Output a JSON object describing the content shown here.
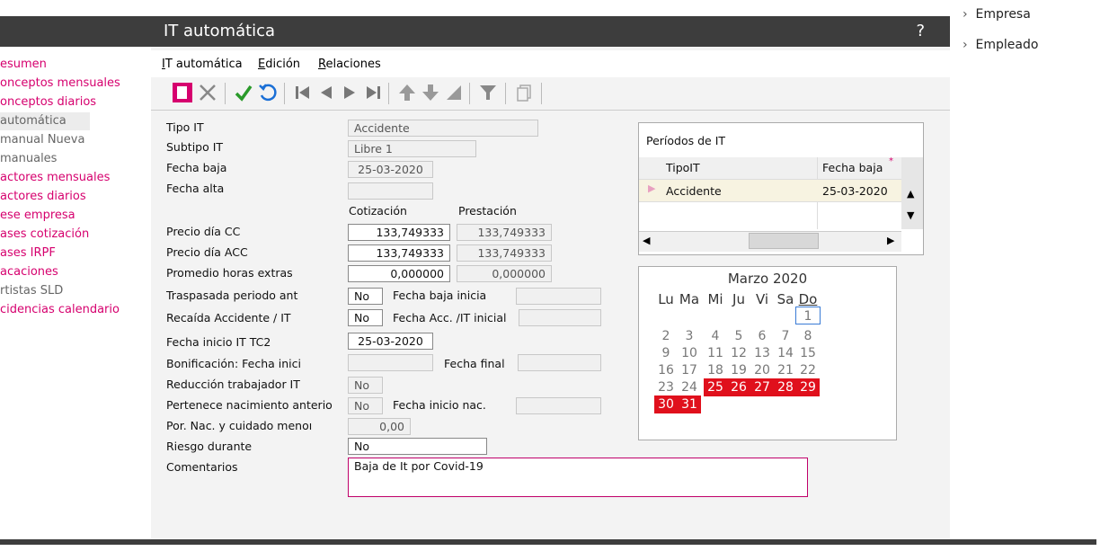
{
  "sidebar": {
    "items": [
      {
        "label": "esumen",
        "type": "main"
      },
      {
        "label": "onceptos mensuales",
        "type": "main"
      },
      {
        "label": "onceptos diarios",
        "type": "main"
      },
      {
        "label": " automática",
        "type": "sub"
      },
      {
        "label": " manual Nueva",
        "type": "sub"
      },
      {
        "label": " manuales",
        "type": "sub"
      },
      {
        "label": "actores mensuales",
        "type": "main"
      },
      {
        "label": "actores diarios",
        "type": "main"
      },
      {
        "label": "ese empresa",
        "type": "main"
      },
      {
        "label": "ases cotización",
        "type": "main"
      },
      {
        "label": "ases IRPF",
        "type": "main"
      },
      {
        "label": "acaciones",
        "type": "main"
      },
      {
        "label": "rtistas SLD",
        "type": "sub"
      },
      {
        "label": "cidencias calendario",
        "type": "main"
      }
    ]
  },
  "window": {
    "title": "IT automática",
    "help": "?"
  },
  "menu": {
    "items": [
      {
        "pre": "",
        "u": "I",
        "post": "T automática"
      },
      {
        "pre": "",
        "u": "E",
        "post": "dición"
      },
      {
        "pre": "",
        "u": "R",
        "post": "elaciones"
      }
    ]
  },
  "form": {
    "tipo_it_label": "Tipo IT",
    "tipo_it_value": "Accidente",
    "subtipo_it_label": "Subtipo IT",
    "subtipo_it_value": "Libre 1",
    "fecha_baja_label": "Fecha baja",
    "fecha_baja_value": "25-03-2020",
    "fecha_alta_label": "Fecha alta",
    "fecha_alta_value": "",
    "col_cotizacion": "Cotización",
    "col_prestacion": "Prestación",
    "precio_cc_label": "Precio día CC",
    "precio_cc_cot": "133,749333",
    "precio_cc_pre": "133,749333",
    "precio_acc_label": "Precio día ACC",
    "precio_acc_cot": "133,749333",
    "precio_acc_pre": "133,749333",
    "promedio_label": "Promedio horas extras",
    "promedio_cot": "0,000000",
    "promedio_pre": "0,000000",
    "traspasada_label": "Traspasada periodo ant",
    "traspasada_value": "No",
    "fecha_baja_inicia_label": "Fecha baja inicia",
    "fecha_baja_inicia_value": "",
    "recaida_label": "Recaída Accidente / IT",
    "recaida_value": "No",
    "fecha_acc_label": "Fecha Acc. /IT inicial",
    "fecha_acc_value": "",
    "fecha_inicio_tc2_label": "Fecha inicio IT TC2",
    "fecha_inicio_tc2_value": "25-03-2020",
    "bonificacion_label": "Bonificación: Fecha inici",
    "bonificacion_value": "",
    "fecha_final_label": "Fecha final",
    "fecha_final_value": "",
    "reduccion_label": "Reducción trabajador IT",
    "reduccion_value": "No",
    "pertenece_label": "Pertenece nacimiento anterio",
    "pertenece_value": "No",
    "fecha_inicio_nac_label": "Fecha inicio nac.",
    "fecha_inicio_nac_value": "",
    "por_nac_label": "Por. Nac. y cuidado menoı",
    "por_nac_value": "0,00",
    "riesgo_label": "Riesgo durante",
    "riesgo_value": "No",
    "comentarios_label": "Comentarios",
    "comentarios_value": "Baja de It por Covid-19"
  },
  "periodos": {
    "title": "Períodos de IT",
    "col_tipo": "TipoIT",
    "col_fecha": "Fecha baja",
    "rows": [
      {
        "tipo": "Accidente",
        "fecha": "25-03-2020"
      }
    ]
  },
  "calendar": {
    "title": "Marzo 2020",
    "weekdays": [
      "Lu",
      "Ma",
      "Mi",
      "Ju",
      "Vi",
      "Sa",
      "Do"
    ],
    "days": [
      [
        "",
        "",
        "",
        "",
        "",
        "",
        "1"
      ],
      [
        "2",
        "3",
        "4",
        "5",
        "6",
        "7",
        "8"
      ],
      [
        "9",
        "10",
        "11",
        "12",
        "13",
        "14",
        "15"
      ],
      [
        "16",
        "17",
        "18",
        "19",
        "20",
        "21",
        "22"
      ],
      [
        "23",
        "24",
        "25",
        "26",
        "27",
        "28",
        "29"
      ],
      [
        "30",
        "31",
        "",
        "",
        "",
        "",
        ""
      ]
    ],
    "highlight_days": [
      "25",
      "26",
      "27",
      "28",
      "29",
      "30",
      "31"
    ],
    "highlight_color": "#e0101c",
    "today": "1"
  },
  "right_panel": {
    "items": [
      "Empresa",
      "Empleado"
    ]
  },
  "colors": {
    "accent": "#d6006e",
    "titlebar": "#3d3d3d",
    "ok_green": "#2a9a2a",
    "undo_blue": "#1a6fd6"
  }
}
